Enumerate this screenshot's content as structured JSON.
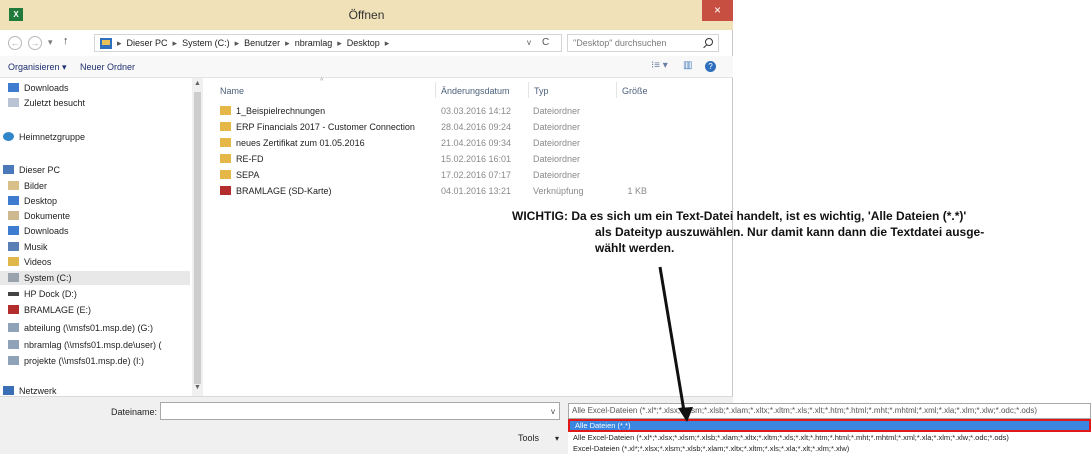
{
  "window": {
    "title": "Öffnen",
    "close_glyph": "×",
    "app_glyph": "X"
  },
  "nav": {
    "back_glyph": "←",
    "forward_glyph": "→",
    "recent_glyph": "▾",
    "up_glyph": "↑",
    "breadcrumbs": [
      "Dieser PC",
      "System (C:)",
      "Benutzer",
      "nbramlag",
      "Desktop"
    ],
    "crumb_separator": "▸",
    "dropdown_glyph": "v",
    "refresh_glyph": "C",
    "search_placeholder": "\"Desktop\" durchsuchen"
  },
  "toolbar": {
    "organize_label": "Organisieren ▾",
    "new_folder_label": "Neuer Ordner",
    "view_glyph": "⁝≡ ▾",
    "pane_glyph": "▥",
    "help_glyph": "?"
  },
  "sidebar": {
    "items": [
      {
        "label": "Downloads",
        "icon": "downloads-icon"
      },
      {
        "label": "Zuletzt besucht",
        "icon": "recent-places-icon"
      },
      {
        "label": "Heimnetzgruppe",
        "icon": "homegroup-icon"
      },
      {
        "label": "Dieser PC",
        "icon": "this-pc-icon"
      },
      {
        "label": "Bilder",
        "icon": "pictures-icon"
      },
      {
        "label": "Desktop",
        "icon": "desktop-icon"
      },
      {
        "label": "Dokumente",
        "icon": "documents-icon"
      },
      {
        "label": "Downloads",
        "icon": "downloads-icon"
      },
      {
        "label": "Musik",
        "icon": "music-icon"
      },
      {
        "label": "Videos",
        "icon": "videos-icon"
      },
      {
        "label": "System (C:)",
        "icon": "drive-icon"
      },
      {
        "label": "HP Dock (D:)",
        "icon": "dvd-drive-icon"
      },
      {
        "label": "BRAMLAGE (E:)",
        "icon": "sd-card-icon"
      },
      {
        "label": "abteilung (\\\\msfs01.msp.de) (G:)",
        "icon": "network-drive-icon"
      },
      {
        "label": "nbramlag (\\\\msfs01.msp.de\\user) (",
        "icon": "network-drive-icon"
      },
      {
        "label": "projekte (\\\\msfs01.msp.de) (I:)",
        "icon": "network-drive-icon"
      },
      {
        "label": "Netzwerk",
        "icon": "network-icon"
      }
    ],
    "scroll_up_glyph": "▲",
    "scroll_down_glyph": "▼"
  },
  "columns": {
    "name": "Name",
    "date": "Änderungsdatum",
    "type": "Typ",
    "size": "Größe",
    "sort_glyph": "^"
  },
  "files": [
    {
      "name": "1_Beispielrechnungen",
      "date": "03.03.2016 14:12",
      "type": "Dateiordner",
      "size": "",
      "icon": "folder-icon"
    },
    {
      "name": "ERP Financials 2017 - Customer Connection",
      "date": "28.04.2016 09:24",
      "type": "Dateiordner",
      "size": "",
      "icon": "folder-icon"
    },
    {
      "name": "neues Zertifikat zum 01.05.2016",
      "date": "21.04.2016 09:34",
      "type": "Dateiordner",
      "size": "",
      "icon": "folder-icon"
    },
    {
      "name": "RE-FD",
      "date": "15.02.2016 16:01",
      "type": "Dateiordner",
      "size": "",
      "icon": "folder-icon"
    },
    {
      "name": "SEPA",
      "date": "17.02.2016 07:17",
      "type": "Dateiordner",
      "size": "",
      "icon": "folder-icon"
    },
    {
      "name": "BRAMLAGE (SD-Karte)",
      "date": "04.01.2016 13:21",
      "type": "Verknüpfung",
      "size": "1 KB",
      "icon": "shortcut-icon"
    }
  ],
  "bottom": {
    "filename_label": "Dateiname:",
    "filename_value": "",
    "filename_dropdown_glyph": "v",
    "tools_label": "Tools",
    "tools_glyph": "▾"
  },
  "filetype": {
    "selected": "Alle Excel-Dateien (*.xl*;*.xlsx;*.xlsm;*.xlsb;*.xlam;*.xltx;*.xltm;*.xls;*.xlt;*.htm;*.html;*.mht;*.mhtml;*.xml;*.xla;*.xlm;*.xlw;*.odc;*.ods)",
    "options": [
      "Alle Dateien (*.*)",
      "Alle Excel-Dateien (*.xl*;*.xlsx;*.xlsm;*.xlsb;*.xlam;*.xltx;*.xltm;*.xls;*.xlt;*.htm;*.html;*.mht;*.mhtml;*.xml;*.xla;*.xlm;*.xlw;*.odc;*.ods)",
      "Excel-Dateien (*.xl*;*.xlsx;*.xlsm;*.xlsb;*.xlam;*.xltx;*.xltm;*.xls;*.xla;*.xlt;*.xlm;*.xlw)"
    ],
    "highlighted_index": 0,
    "highlight_color": "#3a86e0",
    "highlight_border_color": "#e01818"
  },
  "annotation": {
    "line1": "WICHTIG: Da es sich um ein Text-Datei handelt, ist es wichtig, 'Alle Dateien (*.*)'",
    "line2": "als Dateityp auszuwählen. Nur damit kann dann die Textdatei ausge-",
    "line3": "wählt werden."
  }
}
